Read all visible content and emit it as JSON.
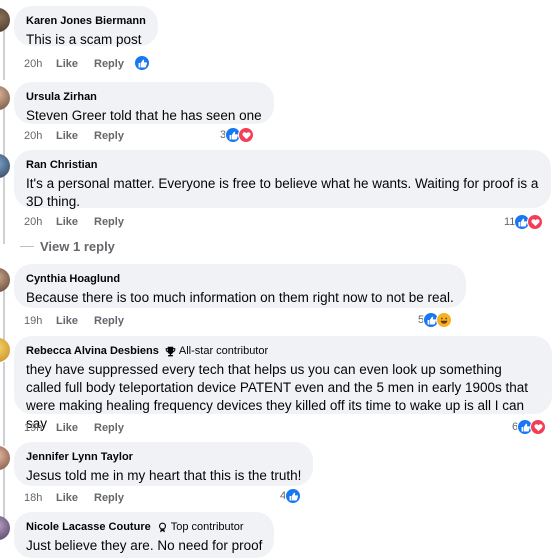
{
  "comments": [
    {
      "author": "Karen Jones Biermann",
      "text": "This is a scam post",
      "time": "20h",
      "like": "Like",
      "reply": "Reply",
      "reaction_count": "",
      "reactions": [
        "like"
      ]
    },
    {
      "author": "Ursula Zirhan",
      "text": "Steven Greer told that he has seen one",
      "time": "20h",
      "like": "Like",
      "reply": "Reply",
      "reaction_count": "3",
      "reactions": [
        "like",
        "love"
      ]
    },
    {
      "author": "Ran Christian",
      "text": "It's a personal matter. Everyone is free to believe what he wants. Waiting for proof is a 3D thing.",
      "time": "20h",
      "like": "Like",
      "reply": "Reply",
      "reaction_count": "11",
      "reactions": [
        "like",
        "love"
      ]
    },
    {
      "author": "Cynthia Hoaglund",
      "text": "Because there is too much information on them right now to not be real.",
      "time": "19h",
      "like": "Like",
      "reply": "Reply",
      "reaction_count": "5",
      "reactions": [
        "like",
        "haha"
      ]
    },
    {
      "author": "Rebecca Alvina Desbiens",
      "badge": "All-star contributor",
      "badge_icon": "trophy-icon",
      "text": "they have suppressed every tech that helps us you can even look up something called full body teleportation device PATENT even and the 5 men in early 1900s that were making healing frequency devices they killed off its time to wake up is all I can say",
      "time": "19h",
      "like": "Like",
      "reply": "Reply",
      "reaction_count": "6",
      "reactions": [
        "like",
        "love"
      ]
    },
    {
      "author": "Jennifer Lynn Taylor",
      "text": "Jesus told me in my heart that this is the truth!",
      "time": "18h",
      "like": "Like",
      "reply": "Reply",
      "reaction_count": "4",
      "reactions": [
        "like"
      ]
    },
    {
      "author": "Nicole Lacasse Couture",
      "badge": "Top contributor",
      "badge_icon": "award-icon",
      "text": "Just believe they are. No need for proof"
    }
  ],
  "view_replies": "View 1 reply",
  "colors": {
    "bubble": "#f0f2f5",
    "meta": "#65676b",
    "like_blue": "#1877f2",
    "love_red": "#f33e58",
    "haha_yellow": "#f7b125"
  }
}
